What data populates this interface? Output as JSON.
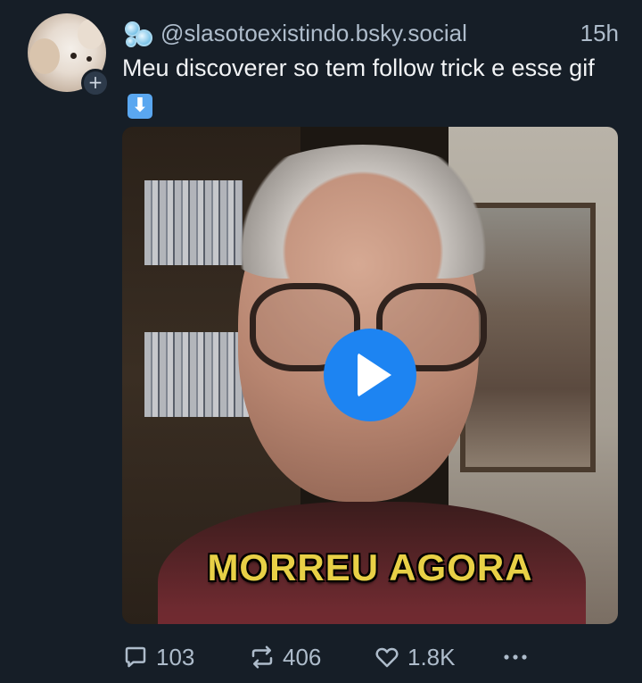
{
  "post": {
    "handle": "@slasotoexistindo.bsky.social",
    "time": "15h",
    "text": "Meu discoverer so tem follow trick e esse gif",
    "emoji": "⬇"
  },
  "author": {
    "avatar_icon": "dog-avatar",
    "badge_icon": "bubbles-icon",
    "follow_symbol": "+"
  },
  "media": {
    "type": "video",
    "caption": "MORREU AGORA",
    "play_icon": "play-icon"
  },
  "actions": {
    "reply_count": "103",
    "repost_count": "406",
    "like_count": "1.8K",
    "more_icon": "more-icon"
  },
  "colors": {
    "background": "#161e27",
    "play": "#1d84f2",
    "caption": "#e8d046",
    "muted_text": "#aebccb"
  }
}
